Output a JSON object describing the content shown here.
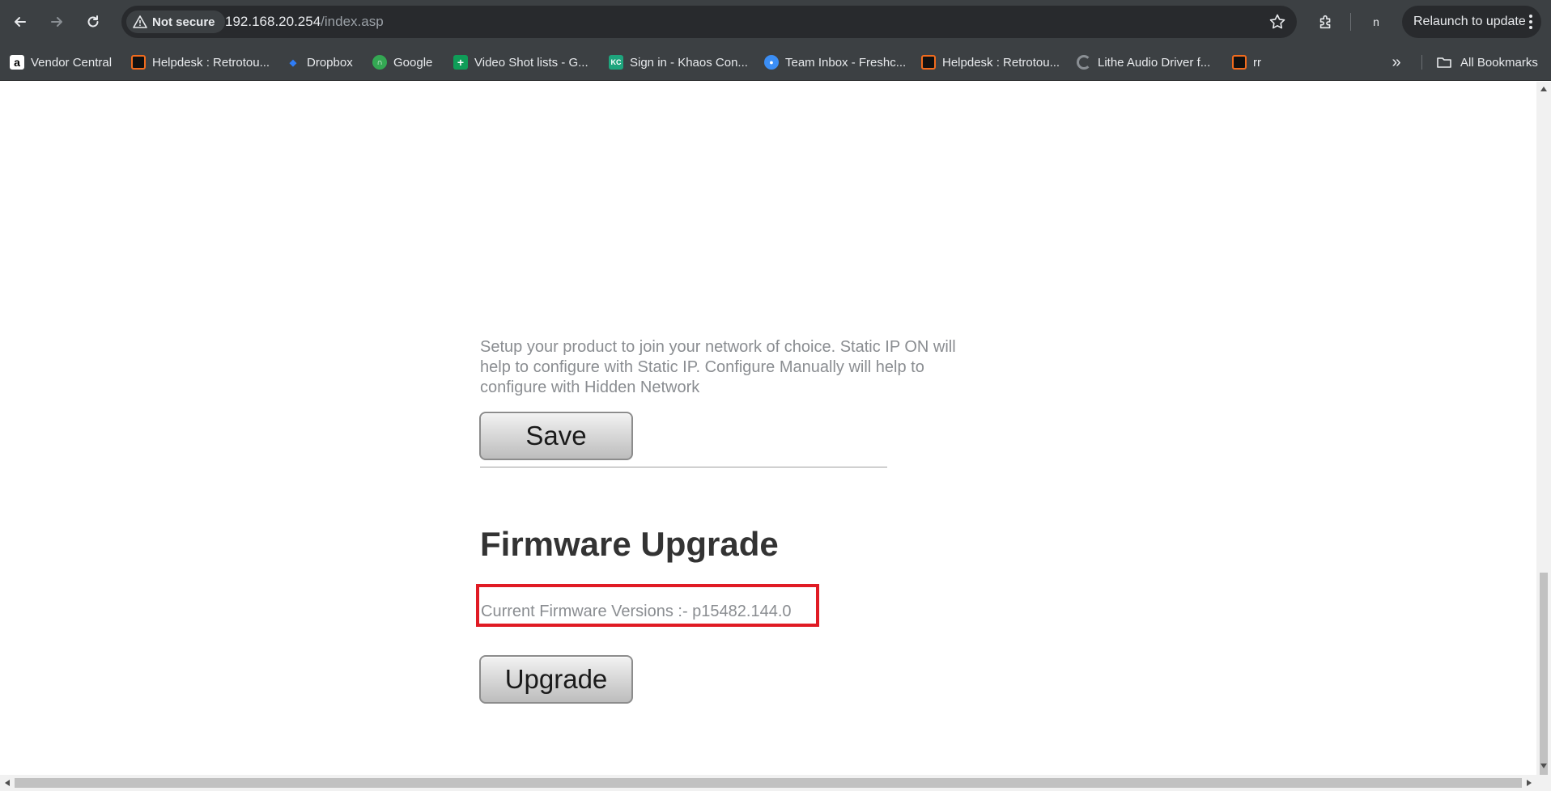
{
  "browser": {
    "security_label": "Not secure",
    "url_host": "192.168.20.254",
    "url_path": "/index.asp",
    "profile_initial": "n",
    "relaunch_label": "Relaunch to update"
  },
  "bookmarks": {
    "items": [
      {
        "label": "Vendor Central",
        "icon": "amazon-icon"
      },
      {
        "label": "Helpdesk : Retrotou...",
        "icon": "helpdesk-icon"
      },
      {
        "label": "Dropbox",
        "icon": "dropbox-icon"
      },
      {
        "label": "Google",
        "icon": "google-icon"
      },
      {
        "label": "Video Shot lists - G...",
        "icon": "sheets-icon"
      },
      {
        "label": "Sign in - Khaos Con...",
        "icon": "khaos-icon"
      },
      {
        "label": "Team Inbox - Freshc...",
        "icon": "freshchat-icon"
      },
      {
        "label": "Helpdesk : Retrotou...",
        "icon": "helpdesk-icon"
      },
      {
        "label": "Lithe Audio Driver f...",
        "icon": "loading-icon"
      },
      {
        "label": "rr",
        "icon": "helpdesk-icon"
      }
    ],
    "all_bookmarks_label": "All Bookmarks"
  },
  "network": {
    "description": "Setup your product to join your network of choice. Static IP ON will help to configure with Static IP. Configure Manually will help to configure with Hidden Network",
    "save_label": "Save"
  },
  "firmware": {
    "title": "Firmware Upgrade",
    "version_text": "Current Firmware Versions :- p15482.144.0",
    "upgrade_label": "Upgrade"
  },
  "colors": {
    "toolbar_bg": "#3c4043",
    "highlight_box": "#e01b24"
  }
}
